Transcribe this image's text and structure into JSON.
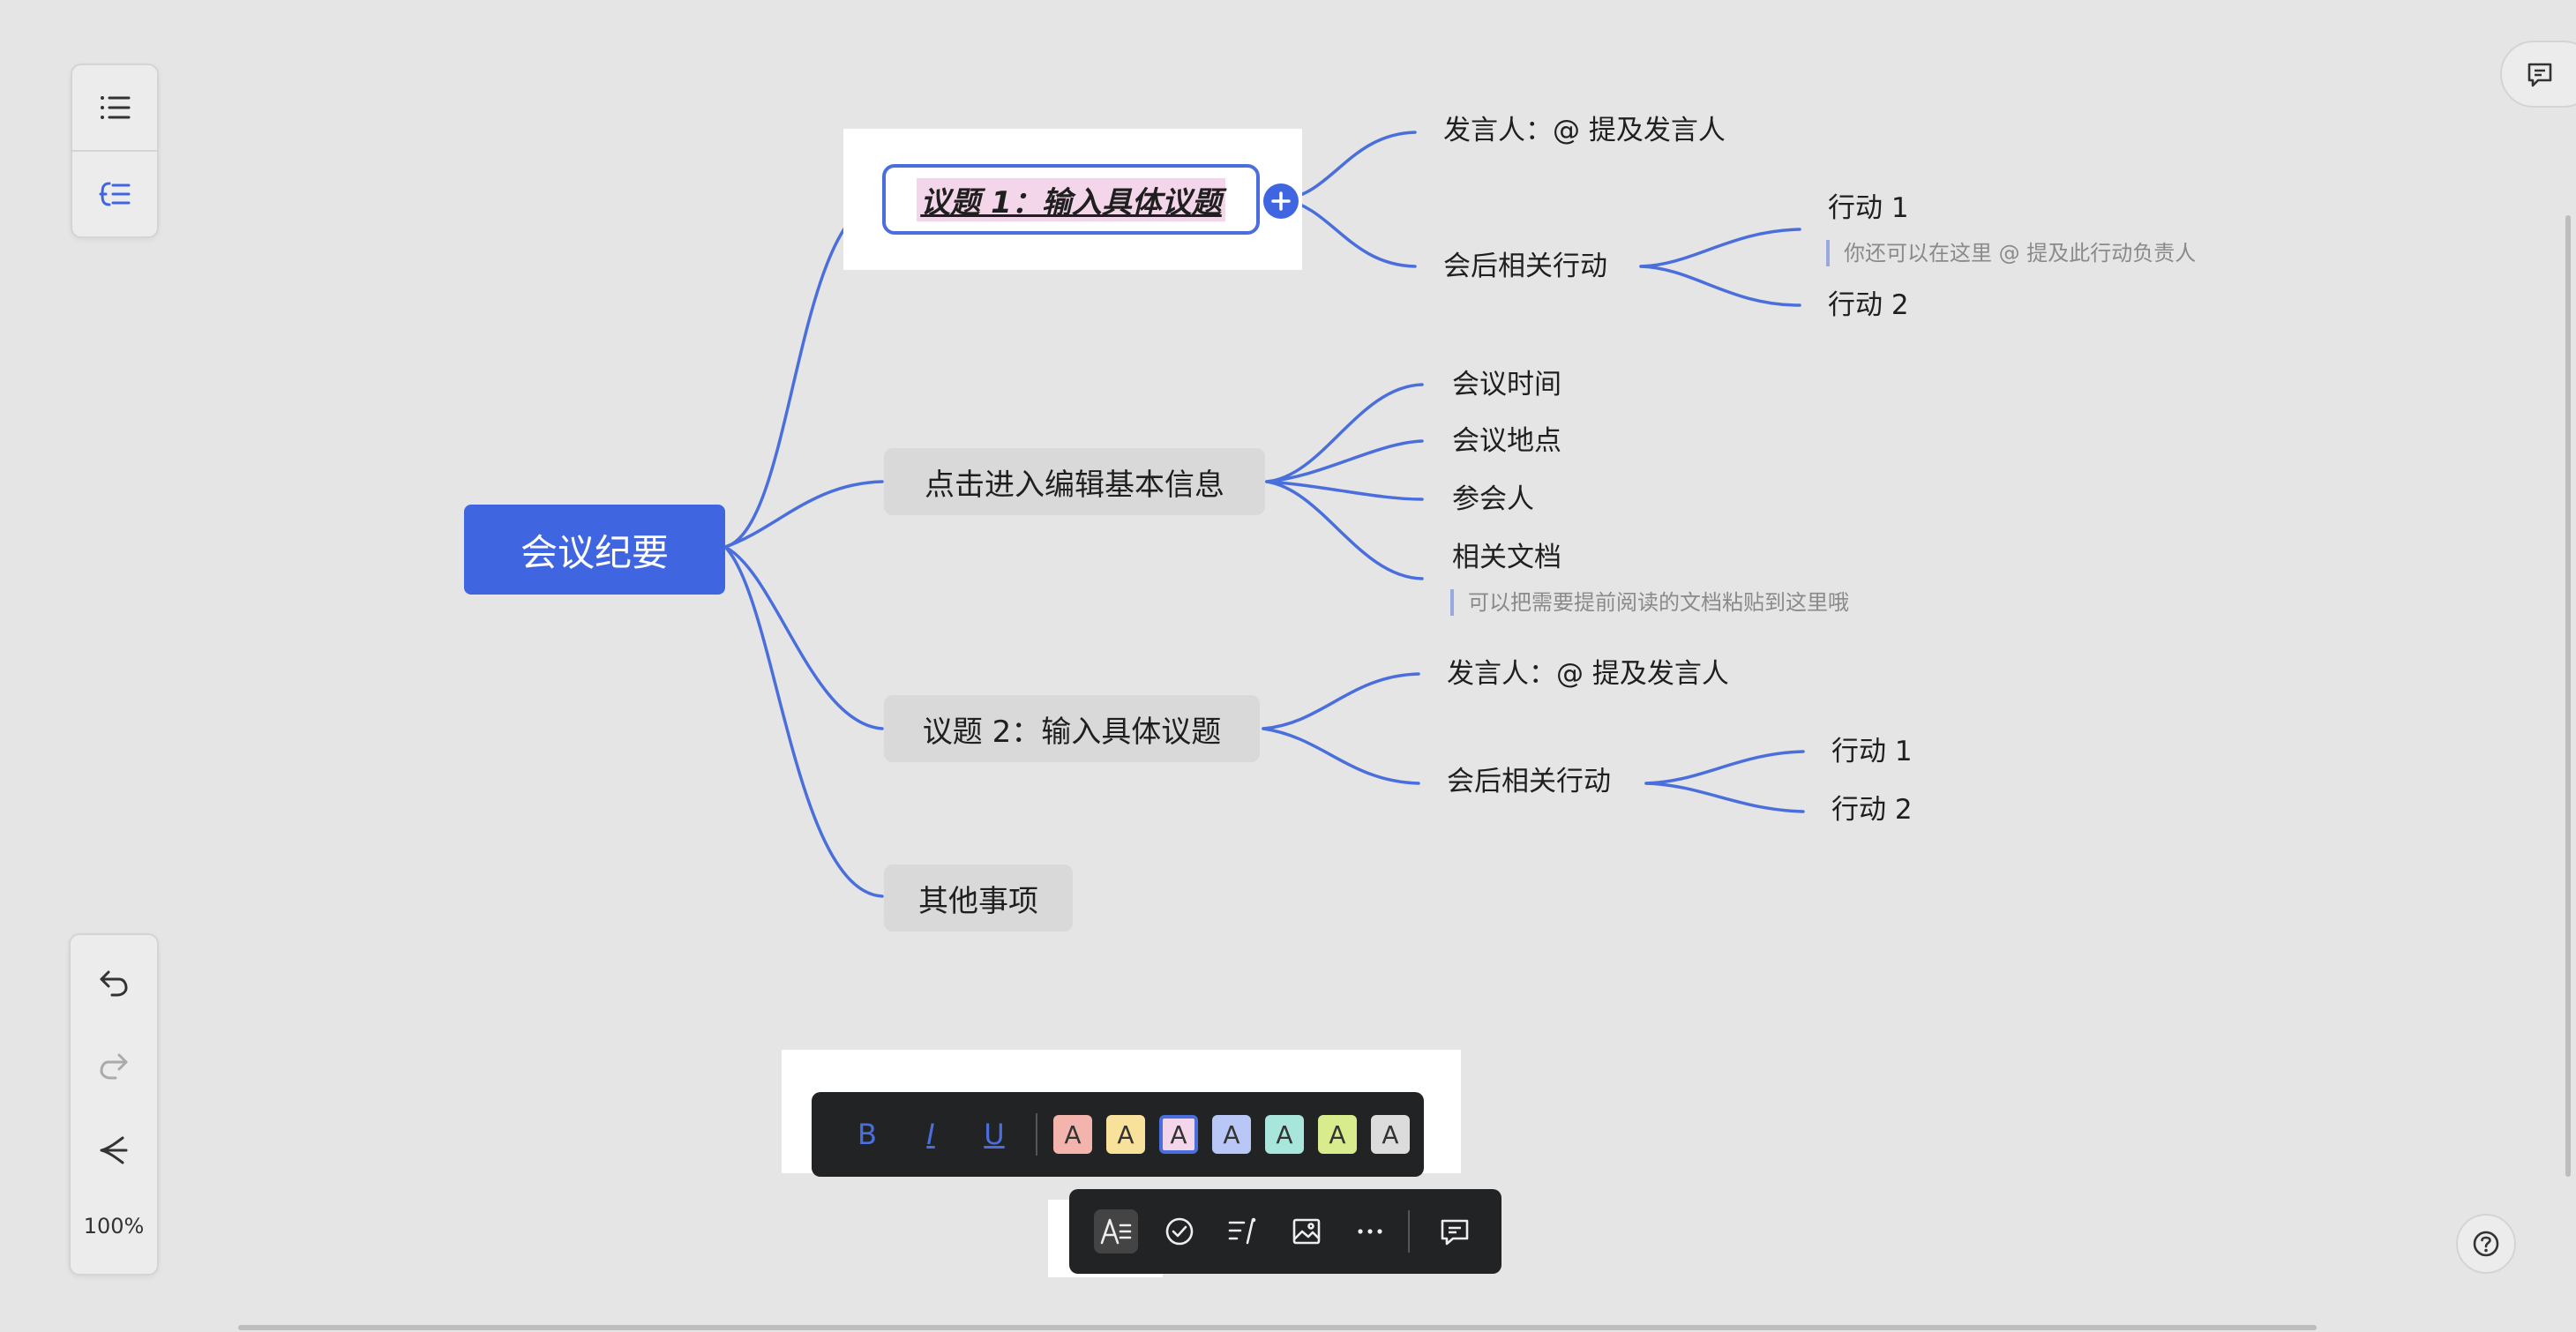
{
  "mindmap": {
    "root": "会议纪要",
    "topic1": {
      "title": "议题 1：输入具体议题",
      "speaker": "发言人：@ 提及发言人",
      "actions": "会后相关行动",
      "action1": "行动 1",
      "action1_note": "你还可以在这里 @ 提及此行动负责人",
      "action2": "行动 2"
    },
    "basic": {
      "title": "点击进入编辑基本信息",
      "time": "会议时间",
      "place": "会议地点",
      "people": "参会人",
      "docs": "相关文档",
      "docs_note": "可以把需要提前阅读的文档粘贴到这里哦"
    },
    "topic2": {
      "title": "议题 2：输入具体议题",
      "speaker": "发言人：@ 提及发言人",
      "actions": "会后相关行动",
      "action1": "行动 1",
      "action2": "行动 2"
    },
    "other": "其他事项"
  },
  "left_toolbar": {
    "outline_icon": "list-icon",
    "structure_icon": "mindmap-structure-icon"
  },
  "bottom_left_toolbar": {
    "undo_icon": "undo-icon",
    "redo_icon": "redo-icon",
    "layout_icon": "layout-icon",
    "zoom": "100%"
  },
  "format_toolbar": {
    "bold": "B",
    "italic": "I",
    "underline": "U",
    "swatch_letter": "A",
    "swatches": [
      {
        "name": "red",
        "bg": "#f3b4ad"
      },
      {
        "name": "yellow",
        "bg": "#f7e19b"
      },
      {
        "name": "pink",
        "bg": "#f4d6ea"
      },
      {
        "name": "blue",
        "bg": "#b8c7f5"
      },
      {
        "name": "teal",
        "bg": "#a8e6dc"
      },
      {
        "name": "lime",
        "bg": "#d8ec8e"
      },
      {
        "name": "gray",
        "bg": "#dcdcdc"
      }
    ]
  },
  "node_toolbar": {
    "icons": [
      "text-style-icon",
      "check-circle-icon",
      "note-icon",
      "image-icon",
      "more-icon",
      "comment-icon"
    ]
  },
  "colors": {
    "accent": "#3f66e0",
    "branch": "#4a6fdc",
    "toolbar_bg": "#222325"
  }
}
